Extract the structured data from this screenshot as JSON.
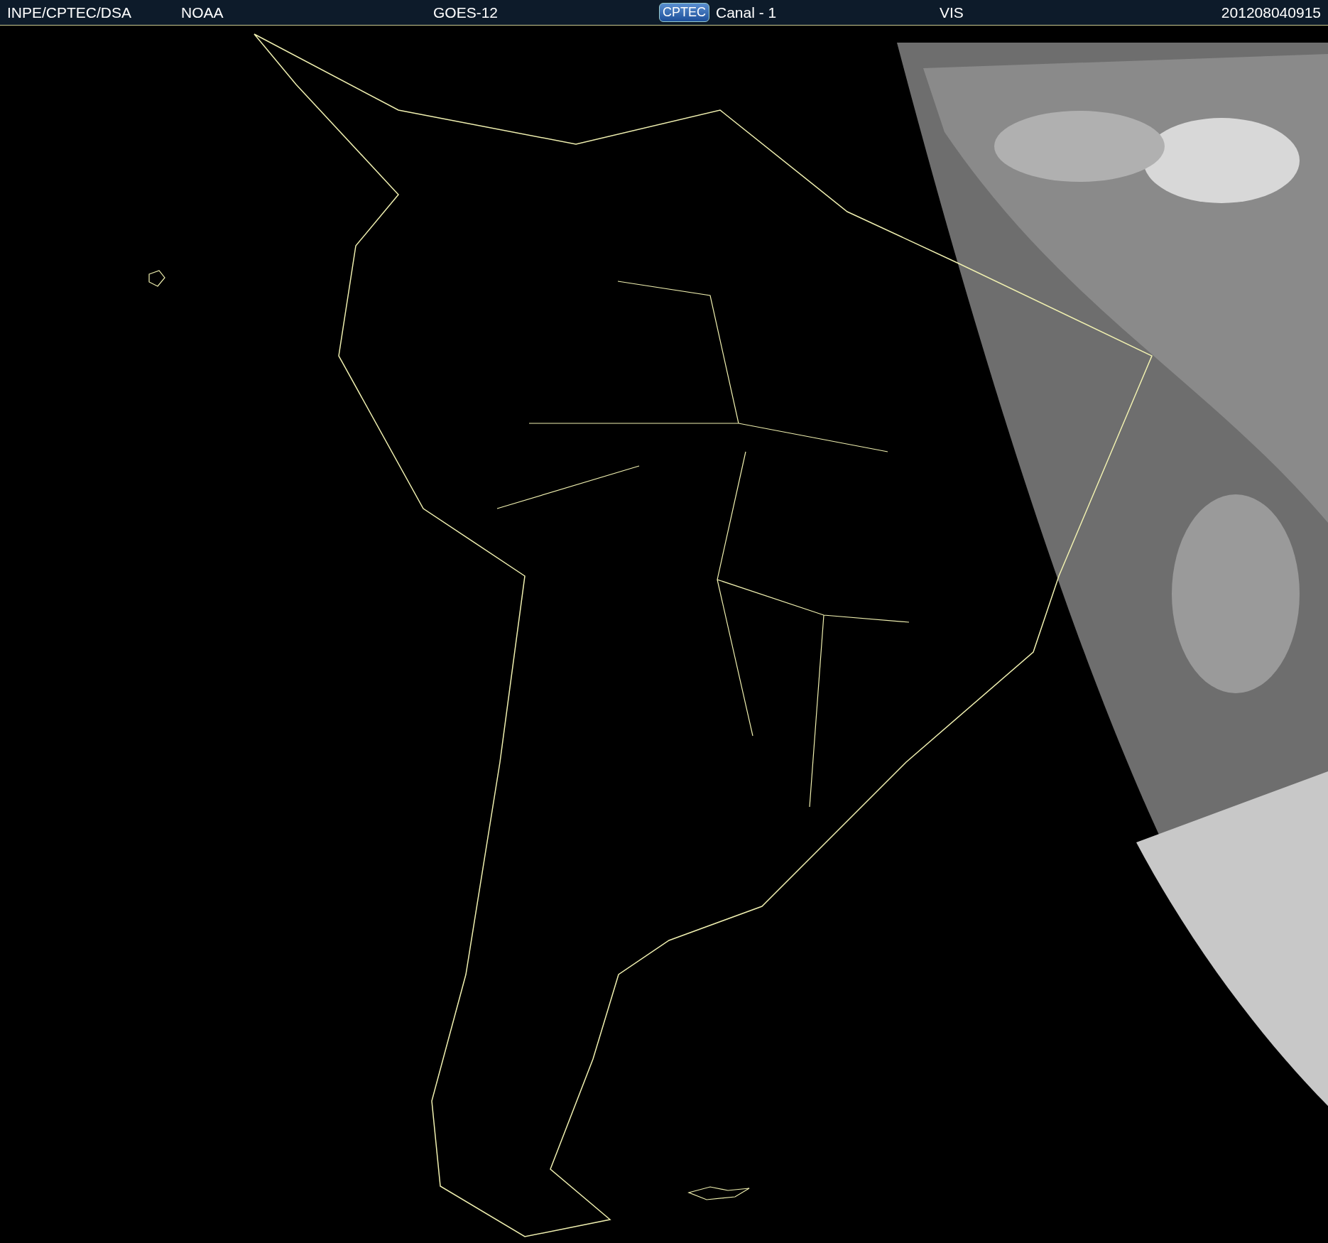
{
  "header": {
    "agency": "INPE/CPTEC/DSA",
    "source": "NOAA",
    "satellite": "GOES-12",
    "logo": "CPTEC",
    "channel": "Canal - 1",
    "band": "VIS",
    "timestamp": "201208040915"
  }
}
